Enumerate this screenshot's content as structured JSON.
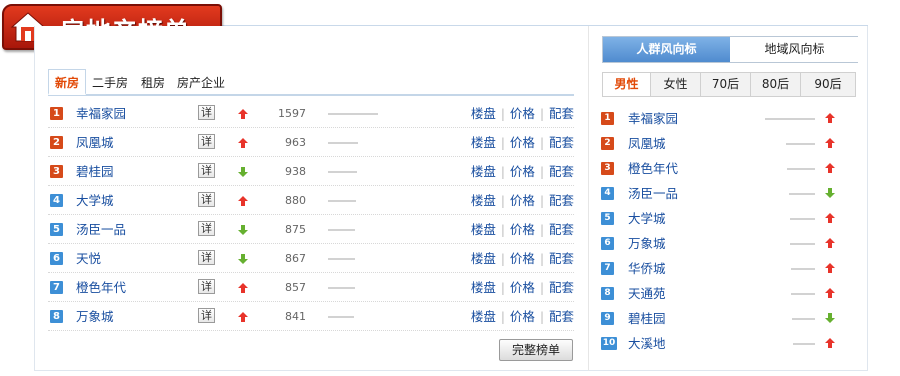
{
  "banner": {
    "title": "房地产榜单",
    "icon": "house-icon"
  },
  "left": {
    "tabs": [
      {
        "label": "新房",
        "active": true
      },
      {
        "label": "二手房",
        "active": false
      },
      {
        "label": "租房",
        "active": false
      },
      {
        "label": "房产企业",
        "active": false
      }
    ],
    "detail_label": "详",
    "links": {
      "loupan": "楼盘",
      "price": "价格",
      "peitao": "配套"
    },
    "rows": [
      {
        "rank": "1",
        "name": "幸福家园",
        "trend": "up",
        "value": 1597
      },
      {
        "rank": "2",
        "name": "凤凰城",
        "trend": "up",
        "value": 963
      },
      {
        "rank": "3",
        "name": "碧桂园",
        "trend": "down",
        "value": 938
      },
      {
        "rank": "4",
        "name": "大学城",
        "trend": "up",
        "value": 880
      },
      {
        "rank": "5",
        "name": "汤臣一品",
        "trend": "down",
        "value": 875
      },
      {
        "rank": "6",
        "name": "天悦",
        "trend": "down",
        "value": 867
      },
      {
        "rank": "7",
        "name": "橙色年代",
        "trend": "up",
        "value": 857
      },
      {
        "rank": "8",
        "name": "万象城",
        "trend": "up",
        "value": 841
      }
    ],
    "full_button": "完整榜单"
  },
  "right": {
    "toggle": [
      {
        "label": "人群风向标",
        "active": true
      },
      {
        "label": "地域风向标",
        "active": false
      }
    ],
    "subtabs": [
      {
        "label": "男性",
        "active": true
      },
      {
        "label": "女性",
        "active": false
      },
      {
        "label": "70后",
        "active": false
      },
      {
        "label": "80后",
        "active": false
      },
      {
        "label": "90后",
        "active": false
      }
    ],
    "rows": [
      {
        "rank": "1",
        "name": "幸福家园",
        "trend": "up",
        "level": 1.0
      },
      {
        "rank": "2",
        "name": "凤凰城",
        "trend": "up",
        "level": 0.58
      },
      {
        "rank": "3",
        "name": "橙色年代",
        "trend": "up",
        "level": 0.56
      },
      {
        "rank": "4",
        "name": "汤臣一品",
        "trend": "down",
        "level": 0.52
      },
      {
        "rank": "5",
        "name": "大学城",
        "trend": "up",
        "level": 0.5
      },
      {
        "rank": "6",
        "name": "万象城",
        "trend": "up",
        "level": 0.5
      },
      {
        "rank": "7",
        "name": "华侨城",
        "trend": "up",
        "level": 0.48
      },
      {
        "rank": "8",
        "name": "天通苑",
        "trend": "up",
        "level": 0.48
      },
      {
        "rank": "9",
        "name": "碧桂园",
        "trend": "down",
        "level": 0.46
      },
      {
        "rank": "10",
        "name": "大溪地",
        "trend": "up",
        "level": 0.44
      }
    ]
  },
  "colors": {
    "up": "#e8332a",
    "down": "#66b030",
    "rank_hot": "#d64a1a",
    "rank_cool": "#3d8fd6",
    "link": "#1a4fa0",
    "accent": "#e24a08"
  },
  "icons": {
    "up": "arrow-up-icon",
    "down": "arrow-down-icon"
  }
}
